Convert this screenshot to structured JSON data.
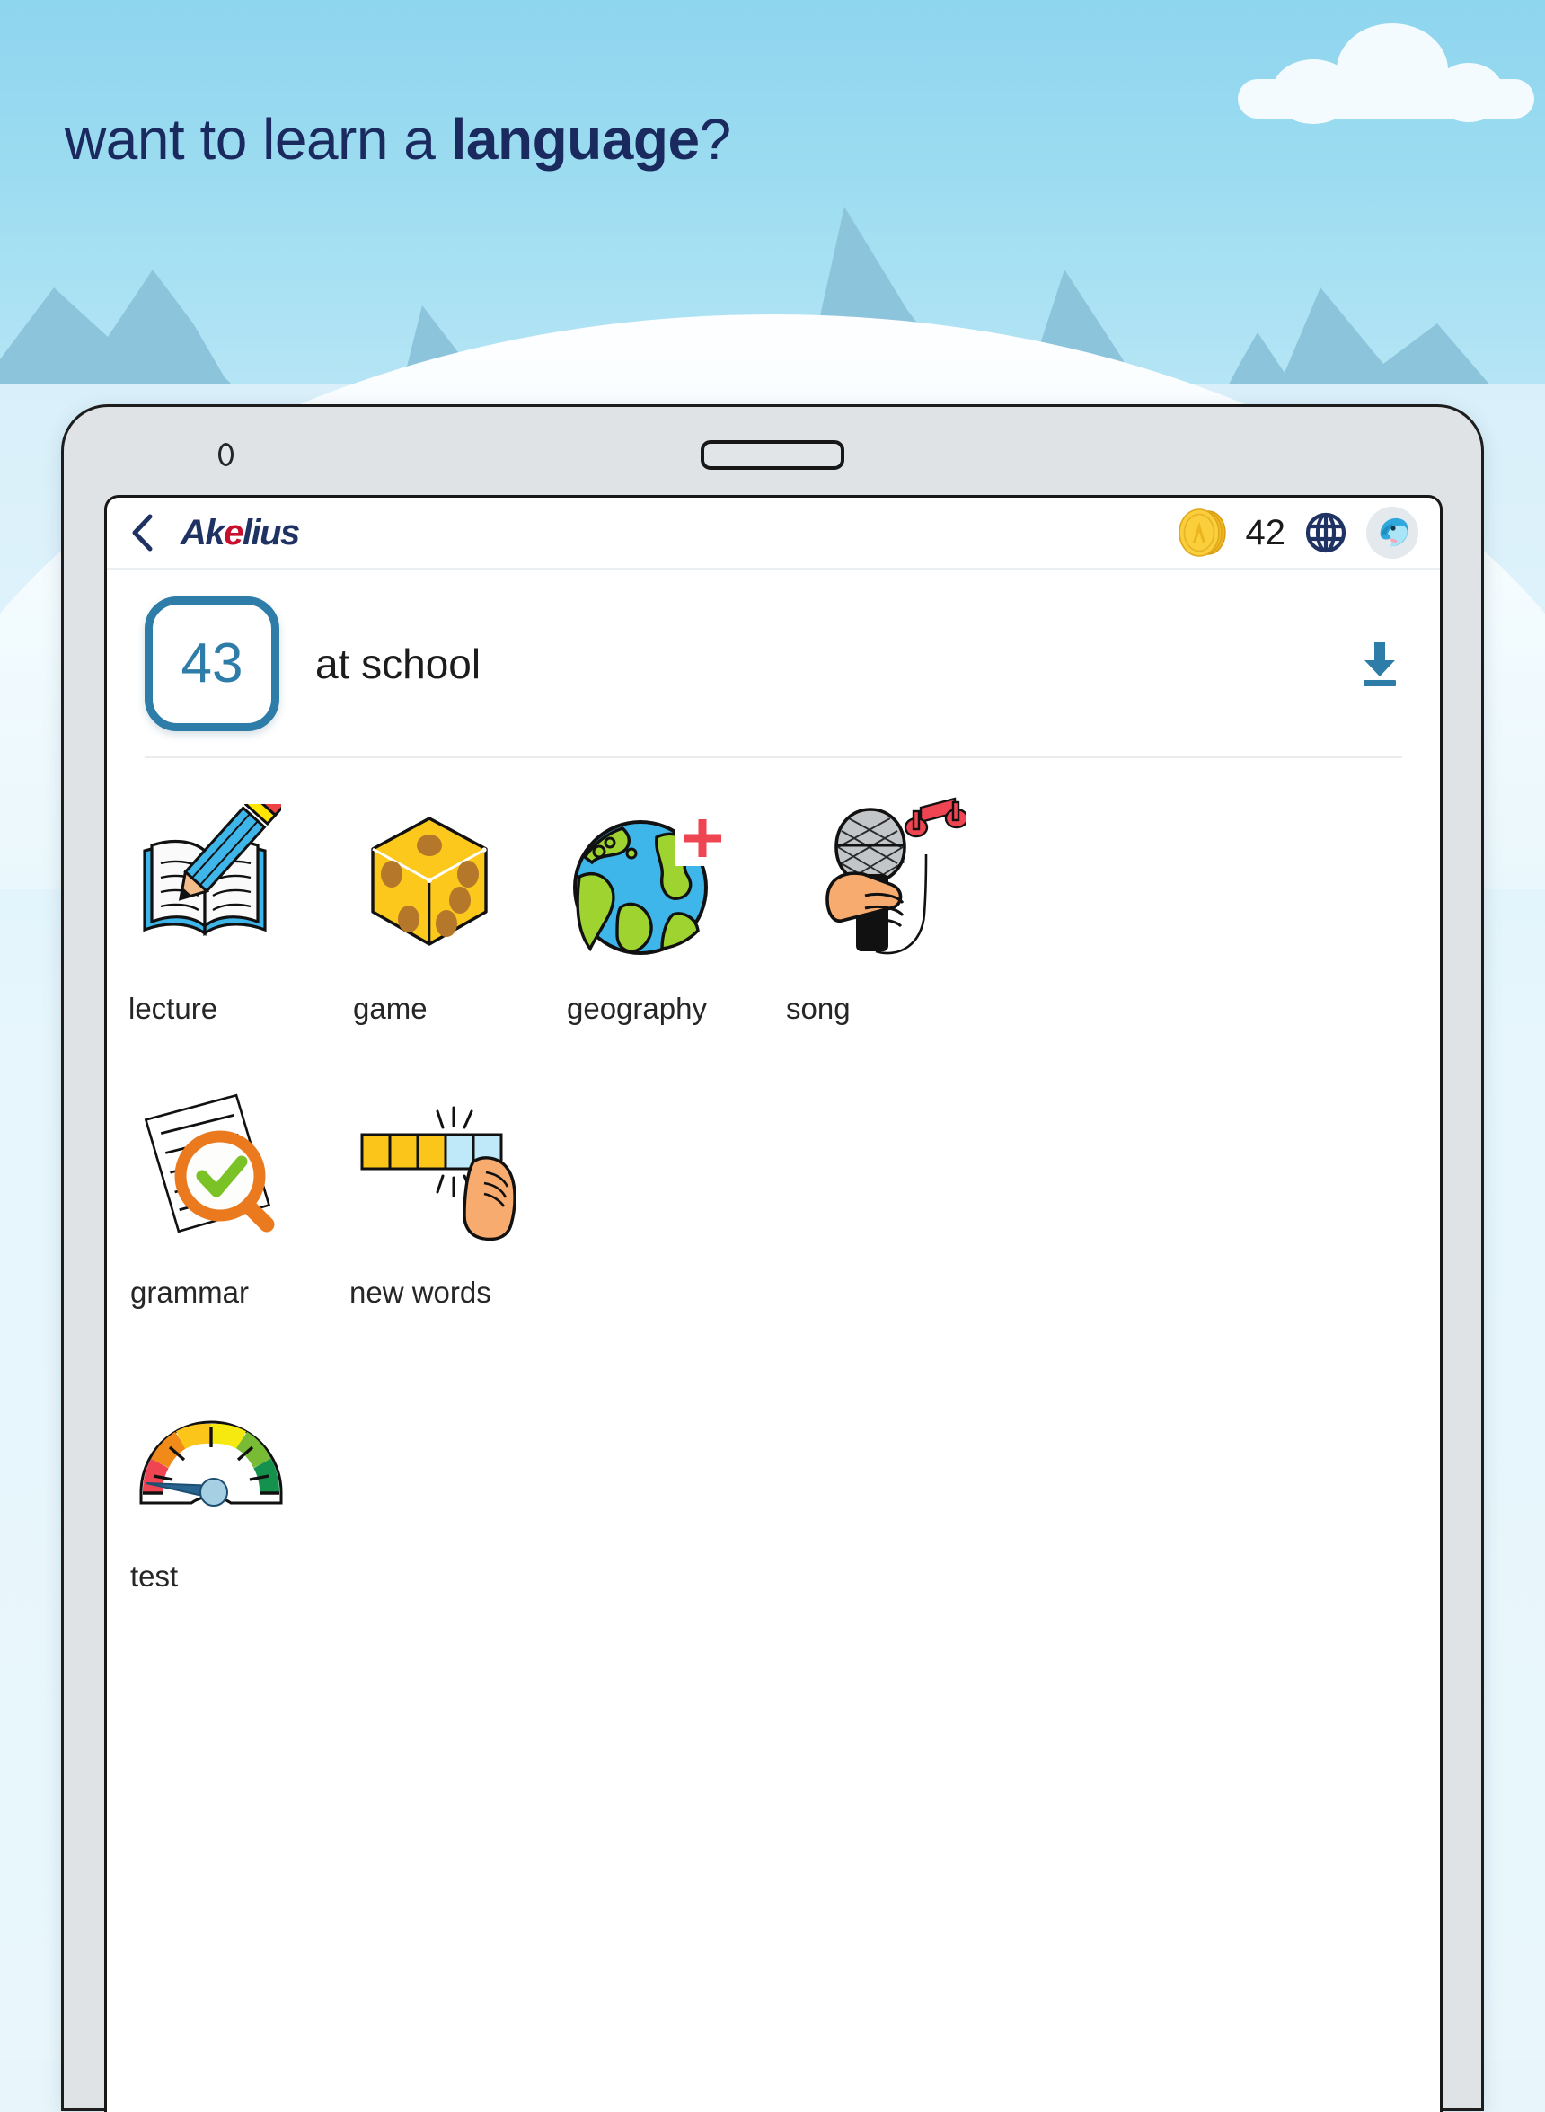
{
  "promo": {
    "headline_plain": "want to learn a ",
    "headline_bold": "language",
    "headline_tail": "?",
    "sky_color": "#9cdcf1",
    "mountain_color": "#8cc4dc",
    "cloud_color": "#f4fbfe"
  },
  "app": {
    "brand_prefix": "Ak",
    "brand_accent": "e",
    "brand_suffix": "lius",
    "back_icon": "chevron-left-icon",
    "coin_icon": "gold-coin-icon",
    "coins": "42",
    "globe_icon": "globe-icon",
    "avatar_icon": "dolphin-avatar-icon",
    "accent_color": "#2e7ca8",
    "brand_color": "#1f3264",
    "brand_accent_color": "#c8102e"
  },
  "lesson": {
    "number": "43",
    "title": "at school",
    "download_icon": "download-icon"
  },
  "activities": [
    {
      "label": "lecture",
      "icon": "book-pencil-icon"
    },
    {
      "label": "game",
      "icon": "dice-icon"
    },
    {
      "label": "geography",
      "icon": "globe-plus-icon"
    },
    {
      "label": "song",
      "icon": "microphone-music-icon"
    },
    {
      "label": "grammar",
      "icon": "document-magnifier-check-icon"
    },
    {
      "label": "new words",
      "icon": "progress-bar-hand-icon"
    },
    {
      "label": "test",
      "icon": "gauge-icon"
    }
  ]
}
